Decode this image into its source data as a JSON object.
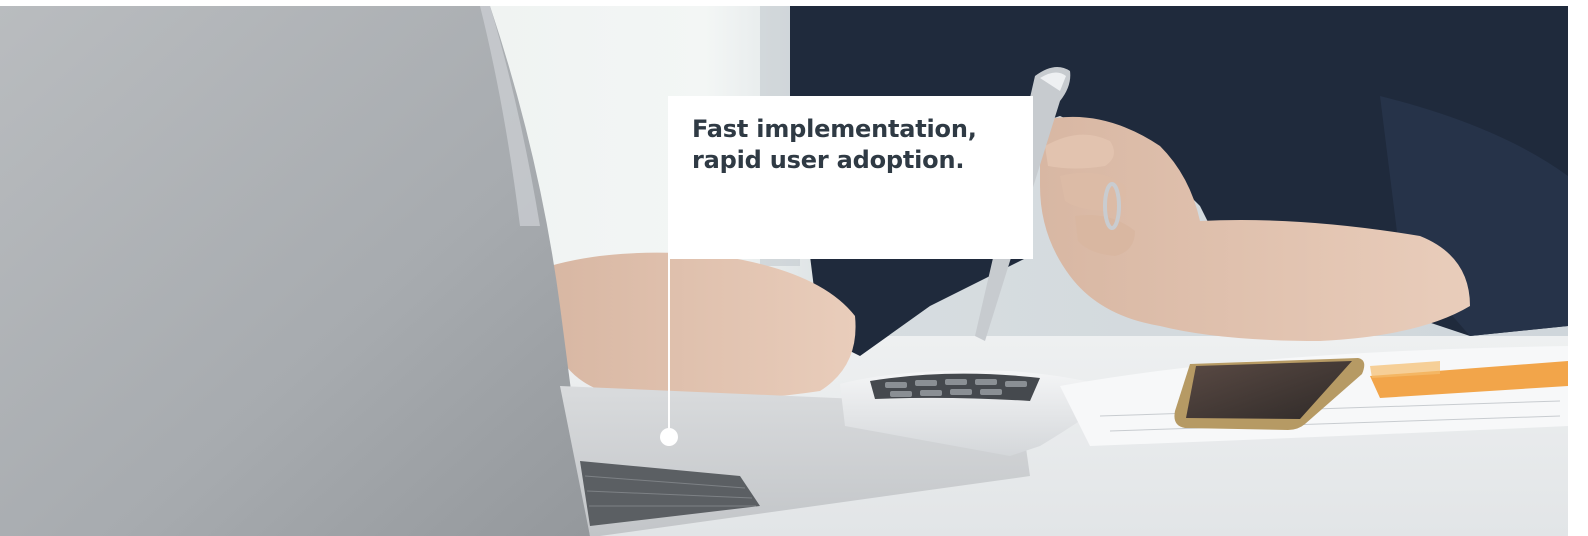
{
  "callout": {
    "line1": "Fast implementation,",
    "line2": "rapid user adoption."
  },
  "colors": {
    "callout_background": "#ffffff",
    "callout_text": "#2f3a44",
    "connector": "#ffffff"
  },
  "photo": {
    "subject": "person-at-desk-with-laptop-calculator-phone"
  }
}
